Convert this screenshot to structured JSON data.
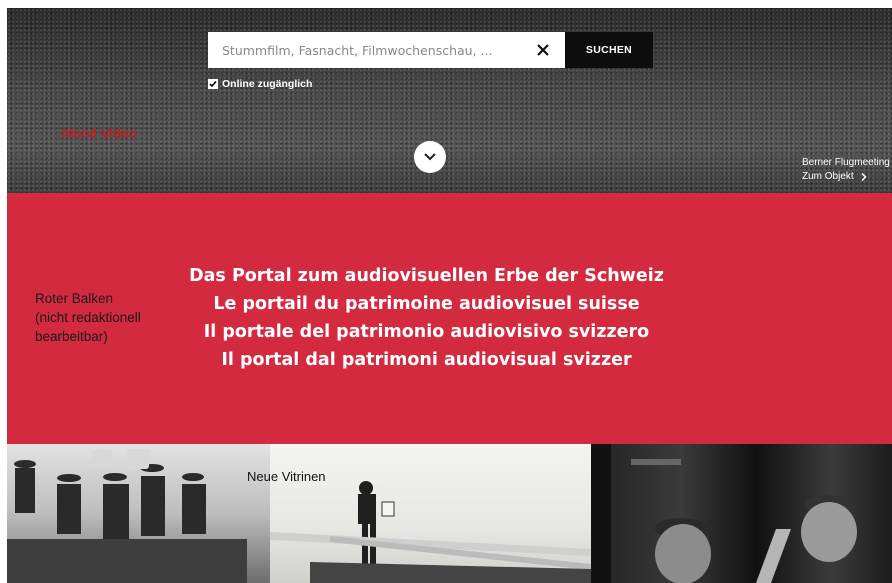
{
  "hero": {
    "search": {
      "placeholder": "Stummfilm, Fasnacht, Filmwochenschau, ...",
      "button_label": "SUCHEN"
    },
    "online_filter_label": "Online zugänglich",
    "mood_label": "Mood Video",
    "featured_object": {
      "title": "Berner Flugmeeting",
      "link_label": "Zum Objekt"
    }
  },
  "red_band": {
    "side_note": [
      "Roter Balken",
      "(nicht redaktionell",
      "bearbeitbar)"
    ],
    "taglines": [
      "Das Portal zum audiovisuellen Erbe der Schweiz",
      "Le portail du patrimoine audiovisuel suisse",
      "Il portale del patrimonio audiovisivo svizzero",
      "Il portal dal patrimoni audiovisual svizzer"
    ],
    "color": "#d32a40"
  },
  "vitrinen": {
    "label": "Neue Vitrinen"
  },
  "icons": [
    "clear-icon",
    "checkmark-icon",
    "chevron-down-icon",
    "chevron-right-icon"
  ]
}
